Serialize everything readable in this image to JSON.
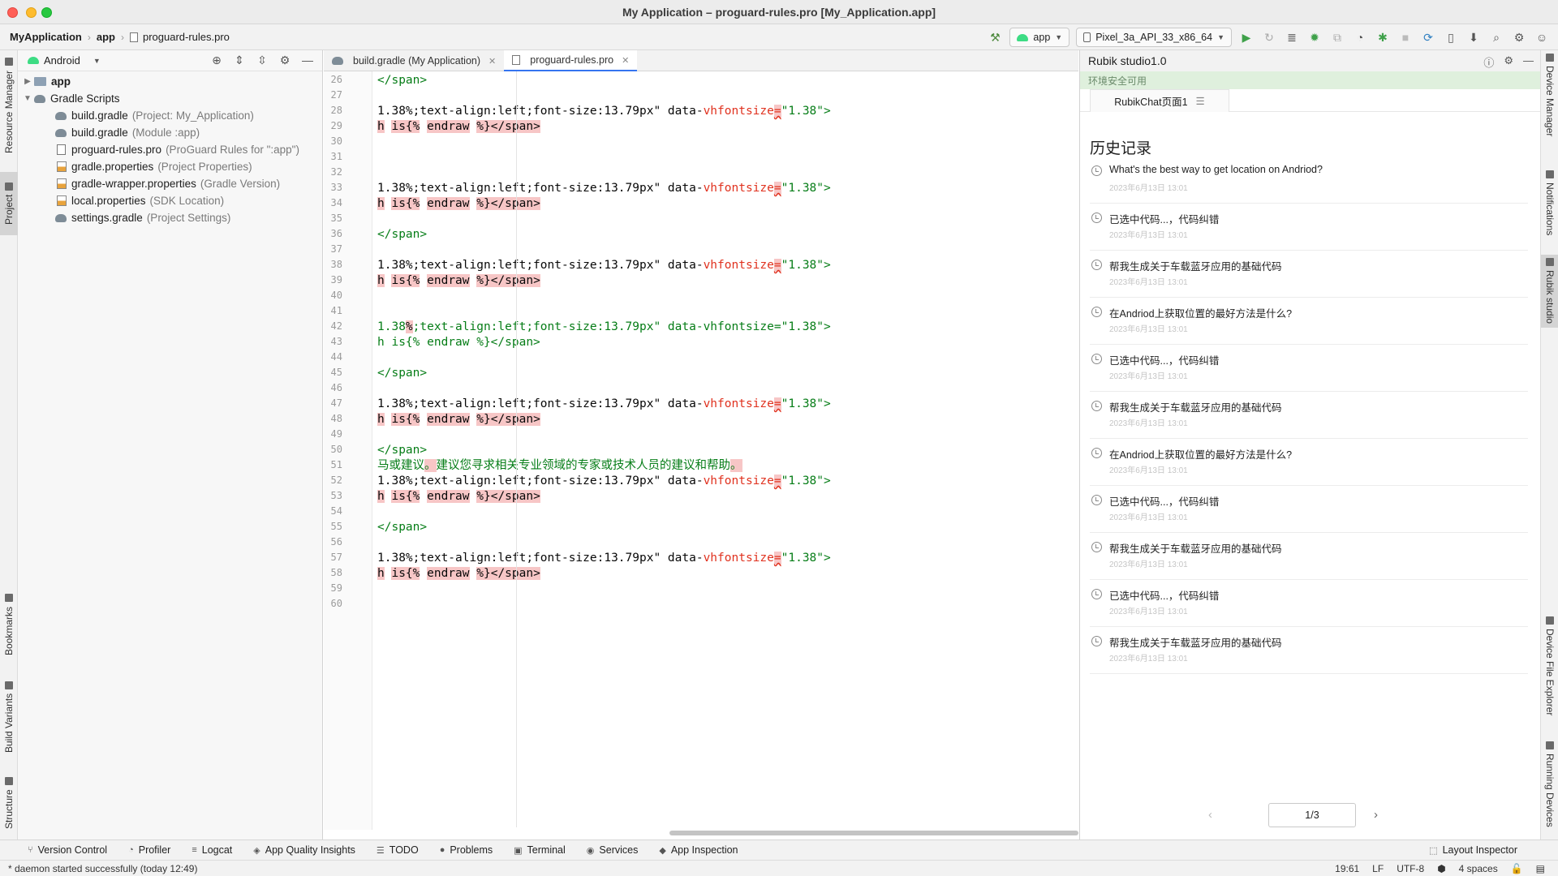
{
  "window": {
    "title": "My Application – proguard-rules.pro [My_Application.app]"
  },
  "breadcrumb": {
    "project": "MyApplication",
    "module": "app",
    "file": "proguard-rules.pro"
  },
  "toolbar": {
    "run_config": "app",
    "device": "Pixel_3a_API_33_x86_64"
  },
  "left_stripe": {
    "resource_manager": "Resource Manager",
    "project": "Project",
    "bookmarks": "Bookmarks",
    "build_variants": "Build Variants",
    "structure": "Structure"
  },
  "right_stripe": {
    "device_manager": "Device Manager",
    "notifications": "Notifications",
    "rubik_studio": "Rubik studio",
    "device_file_explorer": "Device File Explorer",
    "running_devices": "Running Devices"
  },
  "project_panel": {
    "view": "Android",
    "tree": [
      {
        "label": "app",
        "hint": ""
      },
      {
        "label": "Gradle Scripts",
        "hint": ""
      },
      {
        "label": "build.gradle",
        "hint": "(Project: My_Application)"
      },
      {
        "label": "build.gradle",
        "hint": "(Module :app)"
      },
      {
        "label": "proguard-rules.pro",
        "hint": "(ProGuard Rules for \":app\")"
      },
      {
        "label": "gradle.properties",
        "hint": "(Project Properties)"
      },
      {
        "label": "gradle-wrapper.properties",
        "hint": "(Gradle Version)"
      },
      {
        "label": "local.properties",
        "hint": "(SDK Location)"
      },
      {
        "label": "settings.gradle",
        "hint": "(Project Settings)"
      }
    ]
  },
  "editor": {
    "tabs": [
      {
        "label": "build.gradle (My Application)"
      },
      {
        "label": "proguard-rules.pro"
      }
    ],
    "line_numbers": [
      "26",
      "27",
      "28",
      "29",
      "30",
      "31",
      "32",
      "33",
      "34",
      "35",
      "36",
      "37",
      "38",
      "39",
      "40",
      "41",
      "42",
      "43",
      "44",
      "45",
      "46",
      "47",
      "48",
      "49",
      "50",
      "51",
      "52",
      "53",
      "54",
      "55",
      "56",
      "57",
      "58",
      "59",
      "60"
    ],
    "snippets": {
      "close_span": "</span>",
      "style_prefix": "1.38%;text-align:left;font-size:13.79px\" data-",
      "attr": "vhfontsize",
      "eq": "=",
      "attr_value": "\"1.38\">",
      "h": "h",
      "is": "is{%",
      "endraw": "endraw",
      "tail": "%}</span>",
      "l42_a": "1.38",
      "l42_b": "%",
      "l42_c": ";text-align:left;font-size:13.79px\" data-vhfontsize=\"1.38\">",
      "l43": "h is{% endraw %}</span>",
      "l51_a": "马或建议",
      "l51_b": "。",
      "l51_c": "建议您寻求相关专业领域的专家或技术人员的建议和帮助",
      "l51_d": "。"
    }
  },
  "rubik": {
    "title": "Rubik studio1.0",
    "status": "环境安全可用",
    "tab": "RubikChat页面1",
    "history_title": "历史记录",
    "items": [
      {
        "title": "What's the best way to get location on Andriod?",
        "time": "2023年6月13日  13:01"
      },
      {
        "title": "已选中代码...，代码纠错",
        "time": "2023年6月13日  13:01"
      },
      {
        "title": "帮我生成关于车载蓝牙应用的基础代码",
        "time": "2023年6月13日  13:01"
      },
      {
        "title": "在Andriod上获取位置的最好方法是什么?",
        "time": "2023年6月13日  13:01"
      },
      {
        "title": "已选中代码...，代码纠错",
        "time": "2023年6月13日  13:01"
      },
      {
        "title": "帮我生成关于车载蓝牙应用的基础代码",
        "time": "2023年6月13日  13:01"
      },
      {
        "title": "在Andriod上获取位置的最好方法是什么?",
        "time": "2023年6月13日  13:01"
      },
      {
        "title": "已选中代码...，代码纠错",
        "time": "2023年6月13日  13:01"
      },
      {
        "title": "帮我生成关于车载蓝牙应用的基础代码",
        "time": "2023年6月13日  13:01"
      },
      {
        "title": "已选中代码...，代码纠错",
        "time": "2023年6月13日  13:01"
      },
      {
        "title": "帮我生成关于车载蓝牙应用的基础代码",
        "time": "2023年6月13日  13:01"
      }
    ],
    "pager": "1/3"
  },
  "bottom_tools": {
    "version_control": "Version Control",
    "profiler": "Profiler",
    "logcat": "Logcat",
    "app_quality": "App Quality Insights",
    "todo": "TODO",
    "problems": "Problems",
    "terminal": "Terminal",
    "services": "Services",
    "app_inspection": "App Inspection",
    "layout_inspector": "Layout Inspector"
  },
  "status": {
    "message": "* daemon started successfully (today 12:49)",
    "position": "19:61",
    "line_sep": "LF",
    "encoding": "UTF-8",
    "indent": "4 spaces"
  }
}
